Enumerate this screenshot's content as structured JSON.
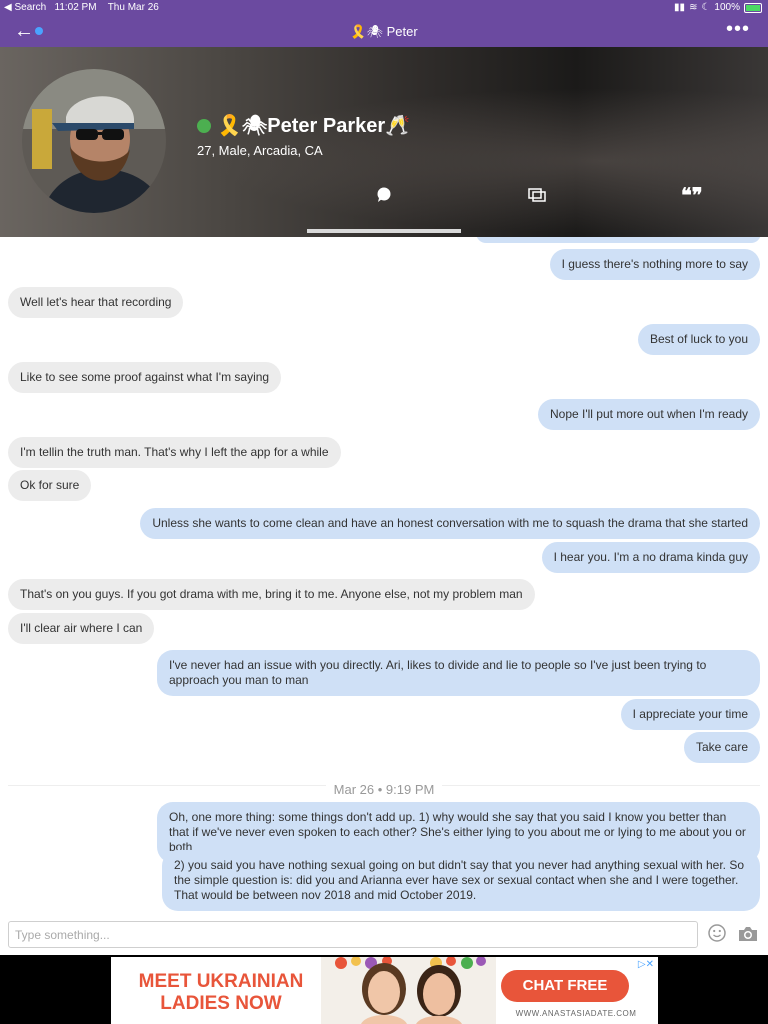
{
  "status_bar": {
    "back_app": "◀ Search",
    "time": "11:02 PM",
    "date": "Thu Mar 26",
    "battery": "100%"
  },
  "nav": {
    "title": "🎗️🕷 Peter"
  },
  "profile": {
    "name": "🎗️🕷Peter Parker🥂",
    "details": "27, Male, Arcadia, CA"
  },
  "messages": [
    {
      "side": "out",
      "text": "I guess there's nothing more to say"
    },
    {
      "side": "in",
      "text": "Well let's hear that recording"
    },
    {
      "side": "out",
      "text": "Best of luck to you"
    },
    {
      "side": "in",
      "text": "Like to see some proof against what I'm saying"
    },
    {
      "side": "out",
      "text": "Nope I'll put more out when I'm ready"
    },
    {
      "side": "in",
      "text": "I'm tellin the truth man. That's why I left the app for a while"
    },
    {
      "side": "in",
      "text": "Ok for sure"
    },
    {
      "side": "out",
      "text": "Unless she wants to come clean and have an honest conversation with me to squash the drama that she started"
    },
    {
      "side": "out",
      "text": "I hear you. I'm a no drama kinda guy"
    },
    {
      "side": "in",
      "text": "That's on you guys. If you got drama with me, bring it to me. Anyone else, not my problem man"
    },
    {
      "side": "in",
      "text": "I'll clear air where I can"
    },
    {
      "side": "out",
      "text": "I've never had an issue with you directly. Ari, likes to divide and lie to people so I've just been trying to approach you man to man"
    },
    {
      "side": "out",
      "text": "I appreciate your time"
    },
    {
      "side": "out",
      "text": "Take care"
    },
    {
      "side": "out",
      "text": "Oh, one more thing: some things don't add up. 1) why would she say that you said I know you better than that if we've never even spoken to each other? She's either lying to you about me or lying to me about you or both"
    },
    {
      "side": "out",
      "text": "2) you said you have nothing sexual going on but didn't say that you never had anything sexual with her. So the simple question is: did you and Arianna ever have sex or sexual contact when she and I were together. That would be between nov 2018 and mid October 2019."
    }
  ],
  "date_divider": "Mar 26 • 9:19 PM",
  "composer": {
    "placeholder": "Type something..."
  },
  "ad": {
    "headline_line1": "MEET UKRAINIAN",
    "headline_line2": "LADIES NOW",
    "cta": "CHAT FREE",
    "url": "WWW.ANASTASIADATE.COM",
    "choices": "▷✕"
  },
  "colors": {
    "header_purple": "#6b4aa0",
    "outgoing_bubble": "#cfe0f6",
    "incoming_bubble": "#ececec",
    "online_green": "#4caf50",
    "ad_orange": "#e8553a"
  }
}
